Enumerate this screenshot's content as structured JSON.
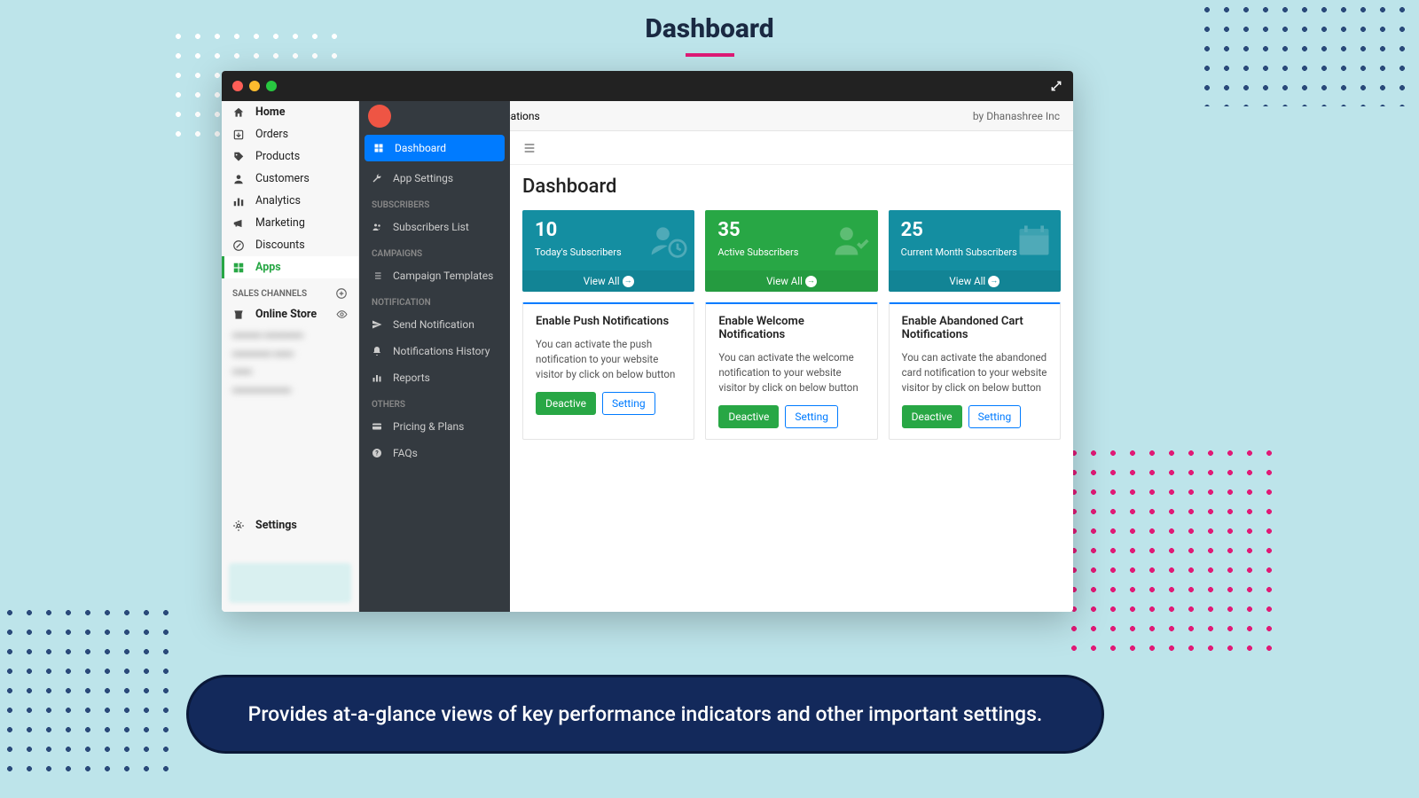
{
  "page": {
    "title": "Dashboard",
    "caption": "Provides at-a-glance views of key performance indicators and other important settings."
  },
  "app_header": {
    "title": "Accu Web Push Notifications",
    "vendor": "by Dhanashree Inc"
  },
  "shopify_nav": {
    "items": [
      {
        "label": "Home",
        "icon": "home"
      },
      {
        "label": "Orders",
        "icon": "orders"
      },
      {
        "label": "Products",
        "icon": "tag"
      },
      {
        "label": "Customers",
        "icon": "user"
      },
      {
        "label": "Analytics",
        "icon": "analytics"
      },
      {
        "label": "Marketing",
        "icon": "megaphone"
      },
      {
        "label": "Discounts",
        "icon": "discount"
      },
      {
        "label": "Apps",
        "icon": "apps",
        "active": true
      }
    ],
    "sales_channels_label": "SALES CHANNELS",
    "online_store": "Online Store",
    "settings": "Settings"
  },
  "app_sidebar": {
    "dashboard": "Dashboard",
    "app_settings": "App Settings",
    "group_subscribers": "SUBSCRIBERS",
    "subscribers_list": "Subscribers List",
    "group_campaigns": "CAMPAIGNS",
    "campaign_templates": "Campaign Templates",
    "group_notification": "NOTIFICATION",
    "send_notification": "Send Notification",
    "notifications_history": "Notifications History",
    "reports": "Reports",
    "group_others": "OTHERS",
    "pricing_plans": "Pricing & Plans",
    "faqs": "FAQs"
  },
  "content": {
    "heading": "Dashboard",
    "stats": [
      {
        "value": "10",
        "label": "Today's Subscribers",
        "view_all": "View All",
        "color": "teal"
      },
      {
        "value": "35",
        "label": "Active Subscribers",
        "view_all": "View All",
        "color": "green"
      },
      {
        "value": "25",
        "label": "Current Month Subscribers",
        "view_all": "View All",
        "color": "teal"
      }
    ],
    "cards": [
      {
        "title": "Enable Push Notifications",
        "body": "You can activate the push notification to your website visitor by click on below button",
        "deactive": "Deactive",
        "setting": "Setting"
      },
      {
        "title": "Enable Welcome Notifications",
        "body": "You can activate the welcome notification to your website visitor by click on below button",
        "deactive": "Deactive",
        "setting": "Setting"
      },
      {
        "title": "Enable Abandoned Cart Notifications",
        "body": "You can activate the abandoned card notification to your website visitor by click on below button",
        "deactive": "Deactive",
        "setting": "Setting"
      }
    ]
  }
}
